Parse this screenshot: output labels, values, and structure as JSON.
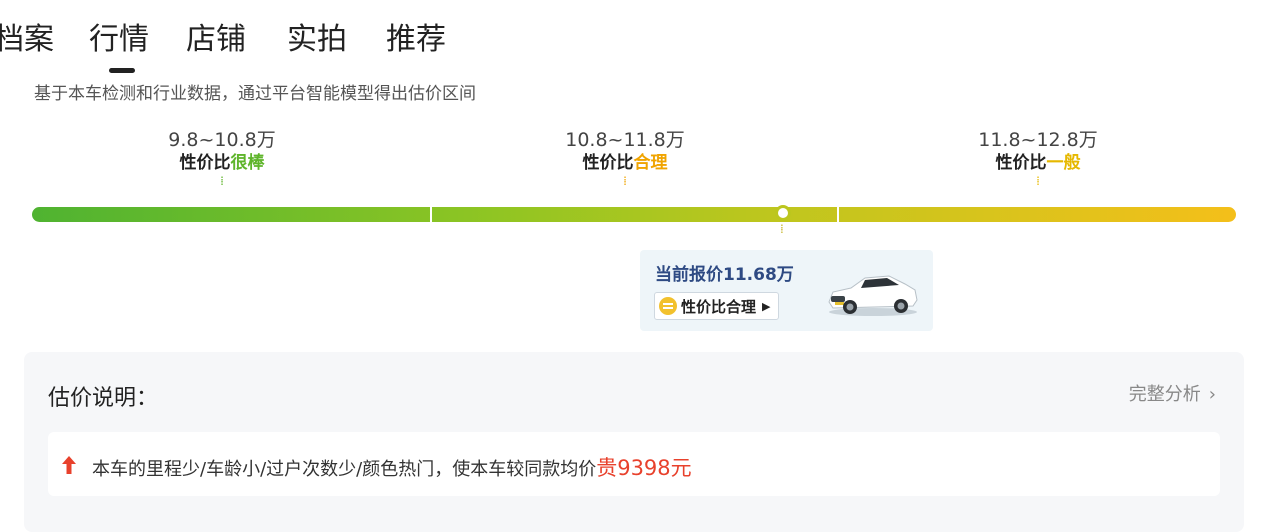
{
  "tabs": [
    "档案",
    "行情",
    "店铺",
    "实拍",
    "推荐"
  ],
  "active_tab": "行情",
  "subtitle": "基于本车检测和行业数据，通过平台智能模型得出估价区间",
  "ranges": [
    {
      "price": "9.8~10.8万",
      "prefix": "性价比",
      "highlight": "很棒",
      "color": "#5fb52b"
    },
    {
      "price": "10.8~11.8万",
      "prefix": "性价比",
      "highlight": "合理",
      "color": "#f0a400"
    },
    {
      "price": "11.8~12.8万",
      "prefix": "性价比",
      "highlight": "一般",
      "color": "#e6b800"
    }
  ],
  "scale": {
    "min": 9.8,
    "max": 12.8,
    "current": 11.68
  },
  "price_card": {
    "current_label": "当前报价11.68万",
    "verdict": "性价比合理",
    "verdict_icon": "equal-badge-icon",
    "car_image": "white-sedan-car-image"
  },
  "panel": {
    "title": "估价说明：",
    "link": "完整分析",
    "reason_prefix": "本车的里程少/车龄小/过户次数少/颜色热门，使本车较同款均价",
    "reason_amount": "贵9398元",
    "reason_icon": "red-up-arrow-icon"
  },
  "colors": {
    "accent_red": "#e8412c",
    "title_blue": "#2e4a83",
    "bar_start": "#4fb331",
    "bar_end": "#f4bf1a"
  }
}
